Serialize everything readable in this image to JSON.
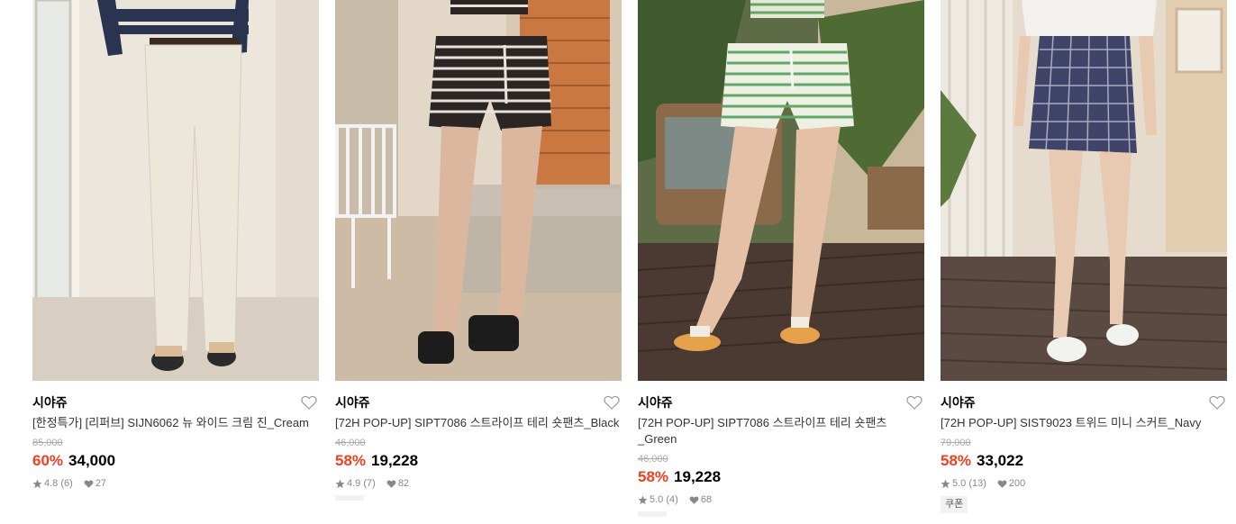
{
  "products": [
    {
      "brand": "시야쥬",
      "title": "[한정특가] [리퍼브] SIJN6062 뉴 와이드 크림 진_Cream",
      "original_price": "85,000",
      "discount": "60%",
      "price": "34,000",
      "rating": "4.8",
      "review_count": "(6)",
      "likes": "27",
      "photo_colors": {
        "bg": "#ece6dc",
        "garment": "#ede7da",
        "floor": "#d8cfc2"
      }
    },
    {
      "brand": "시야쥬",
      "title": "[72H POP-UP] SIPT7086 스트라이프 테리 숏팬츠_Black",
      "original_price": "46,000",
      "discount": "58%",
      "price": "19,228",
      "rating": "4.9",
      "review_count": "(7)",
      "likes": "82",
      "photo_colors": {
        "bg": "#d9c8b4",
        "garment": "#2b2624",
        "floor": "#cdbba5"
      }
    },
    {
      "brand": "시야쥬",
      "title": "[72H POP-UP] SIPT7086 스트라이프 테리 숏팬츠_Green",
      "original_price": "46,000",
      "discount": "58%",
      "price": "19,228",
      "rating": "5.0",
      "review_count": "(4)",
      "likes": "68",
      "photo_colors": {
        "bg": "#6e7a52",
        "garment": "#5fa866",
        "floor": "#4a3a32"
      }
    },
    {
      "brand": "시야쥬",
      "title": "[72H POP-UP] SIST9023 트위드 미니 스커트_Navy",
      "original_price": "79,000",
      "discount": "58%",
      "price": "33,022",
      "rating": "5.0",
      "review_count": "(13)",
      "likes": "200",
      "badge": "쿠폰",
      "photo_colors": {
        "bg": "#e6dccd",
        "garment": "#3f4468",
        "floor": "#5a4a42"
      }
    }
  ],
  "icons": {
    "wishlist": "heart-outline-icon",
    "rating": "star-icon",
    "likes": "heart-filled-icon"
  },
  "colors": {
    "discount": "#f23f1d",
    "original_price": "#aaaaaa",
    "meta_text": "#888888"
  }
}
